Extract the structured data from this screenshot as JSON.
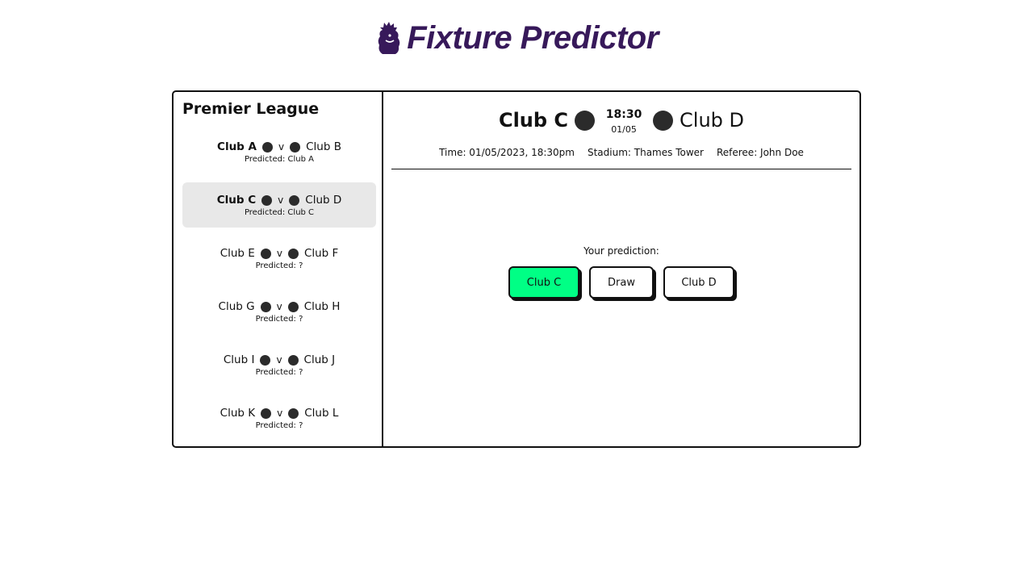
{
  "header": {
    "logo_icon": "lion-crest-icon",
    "title": "Fixture Predictor",
    "title_color": "#37195a"
  },
  "sidebar": {
    "league_title": "Premier League",
    "fixtures": [
      {
        "home": "Club A",
        "vs": "v",
        "away": "Club B",
        "predicted": "Predicted: Club A",
        "selected": false
      },
      {
        "home": "Club C",
        "vs": "v",
        "away": "Club D",
        "predicted": "Predicted: Club C",
        "selected": true
      },
      {
        "home": "Club E",
        "vs": "v",
        "away": "Club F",
        "predicted": "Predicted: ?",
        "selected": false
      },
      {
        "home": "Club G",
        "vs": "v",
        "away": "Club H",
        "predicted": "Predicted: ?",
        "selected": false
      },
      {
        "home": "Club I",
        "vs": "v",
        "away": "Club J",
        "predicted": "Predicted: ?",
        "selected": false
      },
      {
        "home": "Club K",
        "vs": "v",
        "away": "Club L",
        "predicted": "Predicted: ?",
        "selected": false
      }
    ]
  },
  "match": {
    "home": "Club C",
    "away": "Club D",
    "kickoff_time": "18:30",
    "kickoff_date": "01/05",
    "time_info": "Time: 01/05/2023, 18:30pm",
    "stadium_info": "Stadium: Thames Tower",
    "referee_info": "Referee: John Doe"
  },
  "prediction": {
    "label": "Your prediction:",
    "home_button": "Club C",
    "draw_button": "Draw",
    "away_button": "Club D",
    "selected": "home",
    "selected_color": "#00ff85"
  }
}
